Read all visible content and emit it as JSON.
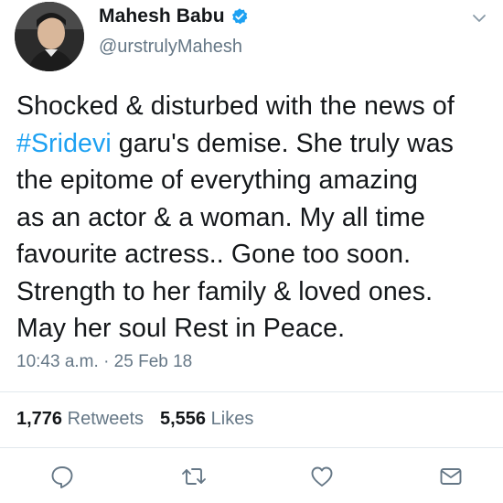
{
  "user": {
    "display_name": "Mahesh Babu",
    "handle": "@urstrulyMahesh",
    "verified": true
  },
  "tweet": {
    "lines": [
      {
        "before": "Shocked & disturbed with the news of",
        "hashtag": "",
        "after": ""
      },
      {
        "before": "",
        "hashtag": "#Sridevi",
        "after": " garu's demise. She truly was"
      },
      {
        "before": "the epitome of everything amazing",
        "hashtag": "",
        "after": ""
      },
      {
        "before": "as an actor & a woman. My all time",
        "hashtag": "",
        "after": ""
      },
      {
        "before": "favourite actress.. Gone too soon.",
        "hashtag": "",
        "after": ""
      },
      {
        "before": "Strength to her family & loved ones.",
        "hashtag": "",
        "after": ""
      },
      {
        "before": "May her soul Rest in Peace.",
        "hashtag": "",
        "after": ""
      }
    ],
    "time": "10:43 a.m.",
    "separator": "·",
    "date": "25 Feb 18"
  },
  "stats": {
    "retweets_count": "1,776",
    "retweets_label": "Retweets",
    "likes_count": "5,556",
    "likes_label": "Likes"
  },
  "actions": [
    "reply-icon",
    "retweet-icon",
    "like-icon",
    "direct-message-icon"
  ],
  "colors": {
    "hashtag": "#1da1f2",
    "secondary_text": "#657786",
    "primary_text": "#14171a",
    "divider": "#e1e8ed",
    "verified": "#1da1f2"
  }
}
